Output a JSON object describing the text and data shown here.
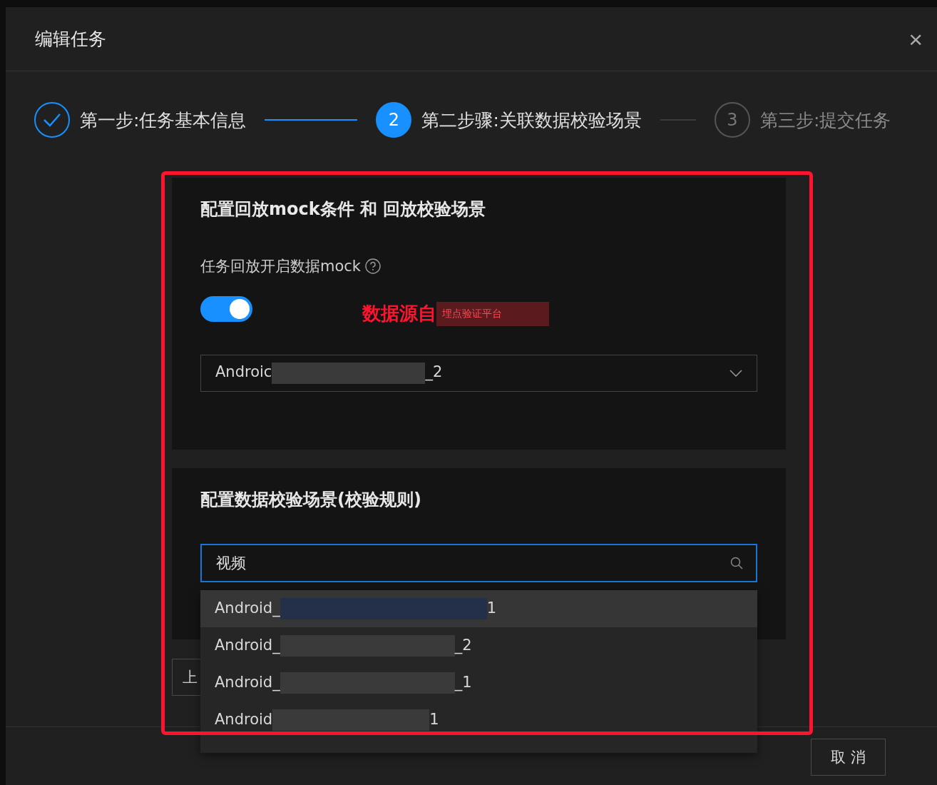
{
  "dialog": {
    "title": "编辑任务",
    "close": "×"
  },
  "steps": [
    {
      "label": "第一步:任务基本信息",
      "done": true,
      "selected": false
    },
    {
      "number": "2",
      "label": "第二步骤:关联数据校验场景",
      "done": false,
      "selected": true
    },
    {
      "number": "3",
      "label": "第三步:提交任务",
      "done": false,
      "selected": false
    }
  ],
  "mock_section": {
    "title": "配置回放mock条件 和 回放校验场景",
    "toggle_label": "任务回放开启数据mock",
    "toggle_on": true,
    "select": {
      "prefix": "Androic",
      "suffix": "_2"
    }
  },
  "annotation": {
    "text": "数据源自",
    "tag": "埋点验证平台"
  },
  "scene_section": {
    "title": "配置数据校验场景(校验规则)",
    "search_value": "视频",
    "options": [
      {
        "prefix": "Android_",
        "suffix": "1",
        "selected": true
      },
      {
        "prefix": "Android_",
        "suffix": "_2",
        "selected": false
      },
      {
        "prefix": "Android_",
        "suffix": "_1",
        "selected": false
      },
      {
        "prefix": "Android",
        "suffix": "1",
        "selected": false
      }
    ]
  },
  "back_button": "上",
  "cancel_button": "取 消"
}
